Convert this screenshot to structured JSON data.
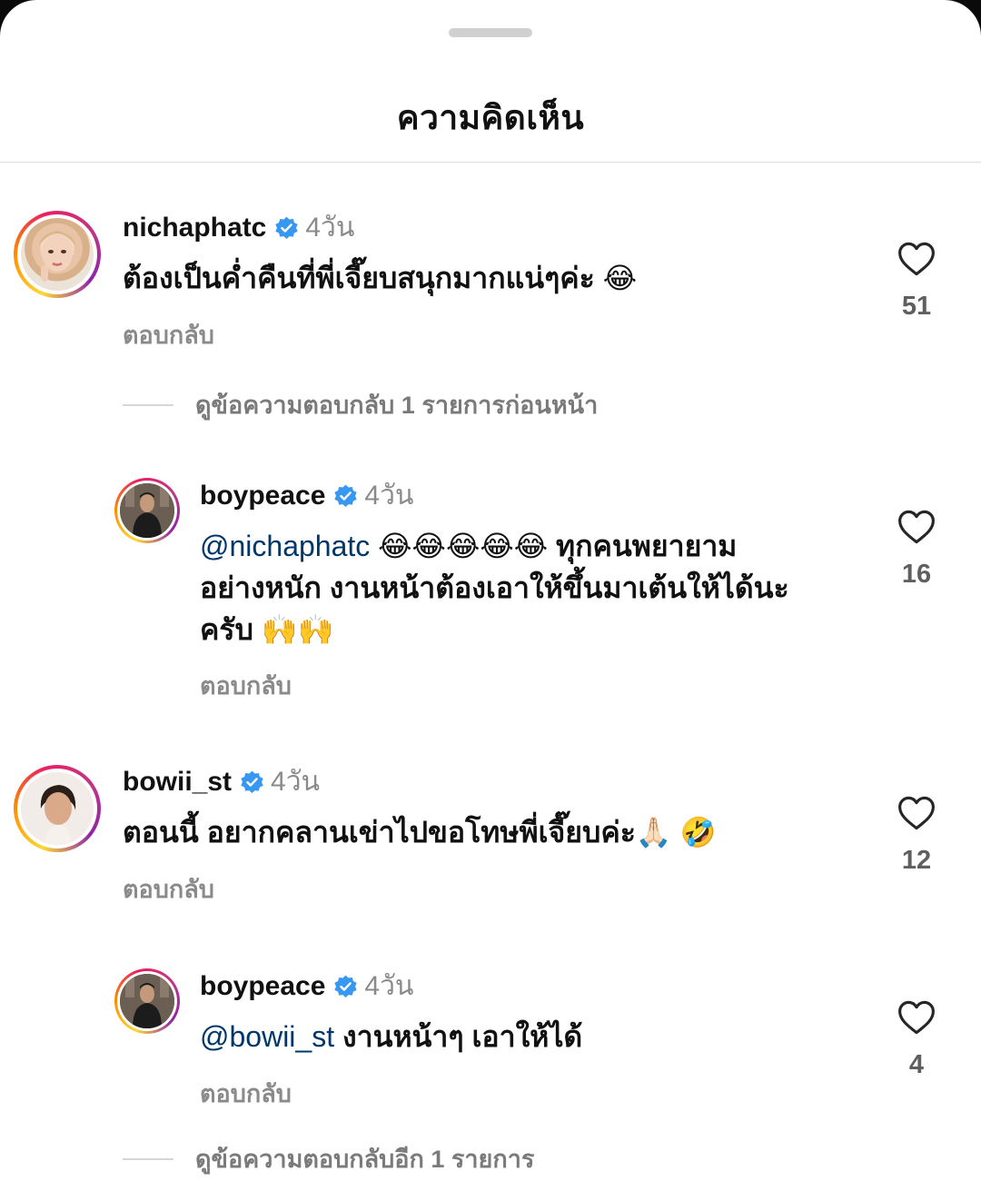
{
  "sheet": {
    "title": "ความคิดเห็น"
  },
  "comments": [
    {
      "username": "nichaphatc",
      "time": "4วัน",
      "text": "ต้องเป็นค่ำคืนที่พี่เจี๊ยบสนุกมากแน่ๆค่ะ 😂",
      "reply_label": "ตอบกลับ",
      "likes": "51"
    },
    {
      "username": "boypeace",
      "time": "4วัน",
      "mention": "@nichaphatc",
      "text_line1": " 😂😂😂😂😂 ทุกคนพยายาม",
      "text_line2": "อย่างหนัก งานหน้าต้องเอาให้ขึ้นมาเต้นให้ได้นะ",
      "text_line3": "ครับ 🙌🙌",
      "reply_label": "ตอบกลับ",
      "likes": "16"
    },
    {
      "username": "bowii_st",
      "time": "4วัน",
      "text": "ตอนนี้ อยากคลานเข่าไปขอโทษพี่เจี๊ยบค่ะ🙏🏻 🤣",
      "reply_label": "ตอบกลับ",
      "likes": "12"
    },
    {
      "username": "boypeace",
      "time": "4วัน",
      "mention": "@bowii_st",
      "text": " งานหน้าๆ เอาให้ได้",
      "reply_label": "ตอบกลับ",
      "likes": "4"
    }
  ],
  "view_previous_replies": "ดูข้อความตอบกลับ 1 รายการก่อนหน้า",
  "view_more_replies": "ดูข้อความตอบกลับอีก 1 รายการ",
  "icons": {
    "verified": "verified-badge-icon",
    "like": "heart-outline-icon"
  },
  "colors": {
    "verified": "#3897f0",
    "mention": "#00376b",
    "secondary_text": "#8a8a8a"
  }
}
